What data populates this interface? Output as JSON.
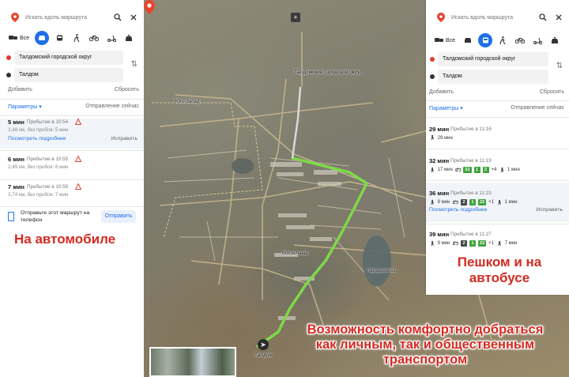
{
  "left_panel": {
    "search_placeholder": "Искать вдоль маршрута",
    "mode_all_label": "Все",
    "from": "Талдомский городской округ",
    "to": "Талдом",
    "add_label": "Добавить",
    "reset_label": "Сбросить",
    "params_label": "Параметры",
    "depart_label": "Отправление сейчас",
    "routes": [
      {
        "time": "5 мин",
        "arrival": "Прибытие в 10:54",
        "details": "2,48 км, без пробок: 5 мин",
        "more": "Посмотреть подробнее",
        "edit": "Исправить"
      },
      {
        "time": "6 мин",
        "arrival": "Прибытие в 10:55",
        "details": "2,49 км, без пробок: 6 мин"
      },
      {
        "time": "7 мин",
        "arrival": "Прибытие в 10:56",
        "details": "2,74 км, без пробок: 7 мин"
      }
    ],
    "send_text": "Отправьте этот маршрут на телефон",
    "send_button": "Отправить"
  },
  "right_panel": {
    "search_placeholder": "Искать вдоль маршрута",
    "mode_all_label": "Все",
    "from": "Талдомский городской округ",
    "to": "Талдом",
    "add_label": "Добавить",
    "reset_label": "Сбросить",
    "params_label": "Параметры",
    "depart_label": "Отправление сейчас",
    "routes": [
      {
        "time": "29 мин",
        "arrival": "Прибытие в 11:16",
        "walk1": "29 мин"
      },
      {
        "time": "32 мин",
        "arrival": "Прибытие в 11:19",
        "walk1": "17 мин",
        "buses": [
          "22",
          "1",
          "2"
        ],
        "extra": "+4",
        "walk2": "1 мин"
      },
      {
        "time": "36 мин",
        "arrival": "Прибытие в 11:23",
        "walk1": "9 мин",
        "buses": [
          "2",
          "1",
          "22"
        ],
        "extra": "+1",
        "walk2": "1 мин",
        "more": "Посмотреть подробнее",
        "edit": "Исправить"
      },
      {
        "time": "39 мин",
        "arrival": "Прибытие в 11:27",
        "walk1": "9 мин",
        "buses": [
          "2",
          "1",
          "22"
        ],
        "extra": "+1",
        "walk2": "7 мин"
      }
    ]
  },
  "map": {
    "destination_label": "Талдомский городской округ",
    "start_label": "Талдом",
    "labels": [
      "Юго-Запад",
      "Вокзальная",
      "Городское оз."
    ]
  },
  "captions": {
    "car": "На автомобиле",
    "bus": "Пешком и на автобусе",
    "bottom": "Возможность комфортно добраться как личным, так и общественным транспортом"
  },
  "colors": {
    "accent": "#1f6fe8",
    "route": "#7fd84a",
    "caption": "#d42a20",
    "bus_badge": "#3fa33c"
  }
}
